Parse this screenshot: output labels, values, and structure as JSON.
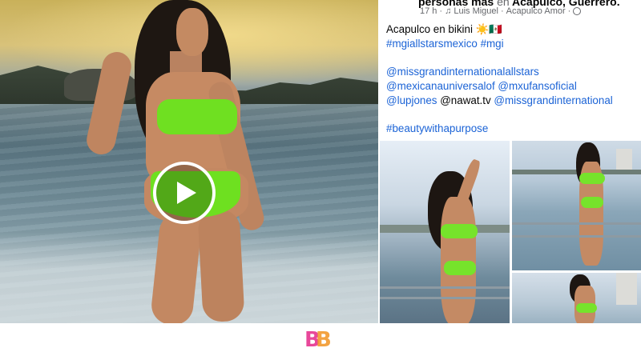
{
  "post": {
    "group_name_prefix": "personas más",
    "group_name_connector": "en",
    "group_name_place": "Acapulco, Guerrero.",
    "time": "17 h",
    "author": "Luis Miguel",
    "location": "Acapulco Amor",
    "caption": {
      "title": "Acapulco en bikini ☀️🇲🇽",
      "hashtags_1": "#mgiallstarsmexico #mgi",
      "mention_1": "@missgrandinternationalallstars",
      "mention_2": "@mexicanauniversalof @mxufansoficial",
      "mention_3a": "@lupjones",
      "mention_3b": "@nawat.tv",
      "mention_3c": "@missgrandinternational",
      "hashtags_2": "#beautywithapurpose"
    }
  },
  "icons": {
    "play": "play-icon",
    "music": "music-note-icon",
    "privacy": "globe-icon",
    "brand": "bb-logo"
  },
  "colors": {
    "link": "#1b63d6",
    "bikini": "#6fe021",
    "logo_pink": "#e8479a",
    "logo_orange": "#f29a2e"
  }
}
